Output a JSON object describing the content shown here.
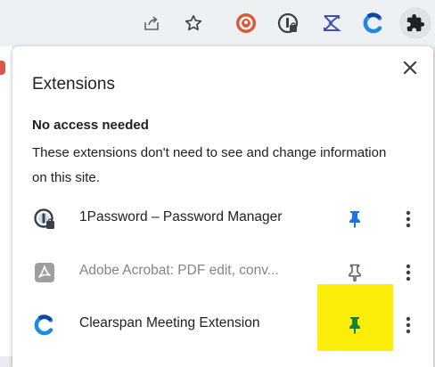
{
  "popup": {
    "title": "Extensions",
    "section_title": "No access needed",
    "section_description": "These extensions don't need to see and change information on this site."
  },
  "extensions": [
    {
      "name": "1Password – Password Manager",
      "icon": "1password-icon",
      "pinned": true,
      "dimmed": false,
      "pin_color": "#1a73e8"
    },
    {
      "name": "Adobe Acrobat: PDF edit, conv...",
      "icon": "adobe-acrobat-icon",
      "pinned": false,
      "dimmed": true,
      "pin_color": "#5f6368"
    },
    {
      "name": "Clearspan Meeting Extension",
      "icon": "clearspan-icon",
      "pinned": true,
      "dimmed": false,
      "pin_color": "#188038"
    }
  ],
  "toolbar": {
    "icons": [
      "share-icon",
      "bookmark-star-icon",
      "duckduckgo-icon",
      "1password-icon",
      "sigma-icon",
      "clearspan-icon",
      "extensions-puzzle-icon"
    ]
  },
  "colors": {
    "highlight": "#fcee08",
    "pinned_blue": "#1a73e8",
    "pinned_green": "#188038"
  }
}
